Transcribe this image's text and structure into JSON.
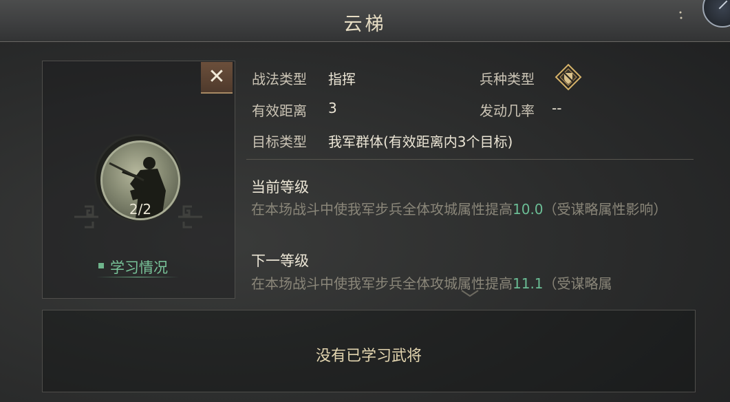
{
  "window": {
    "title": "云梯"
  },
  "close_button": {
    "glyph": "✕"
  },
  "skill": {
    "level_progress": "2/2",
    "study_label": "学习情况"
  },
  "attributes": {
    "tactic_type_label": "战法类型",
    "tactic_type_value": "指挥",
    "troop_type_label": "兵种类型",
    "troop_type_icon": "shield-diamond-icon",
    "range_label": "有效距离",
    "range_value": "3",
    "trigger_rate_label": "发动几率",
    "trigger_rate_value": "--",
    "target_type_label": "目标类型",
    "target_type_value": "我军群体(有效距离内3个目标)"
  },
  "current_level": {
    "title": "当前等级",
    "desc_prefix": "在本场战斗中使我军步兵全体攻城属性提高",
    "value": "10.0",
    "desc_suffix": "（受谋略属性影响）"
  },
  "next_level": {
    "title": "下一等级",
    "desc_prefix": "在本场战斗中使我军步兵全体攻城属性提高",
    "value": "11.1",
    "desc_suffix": "（受谋略属"
  },
  "generals": {
    "empty_text": "没有已学习武将"
  },
  "colors": {
    "highlight": "#6bbd95",
    "accent_gold": "#d6b36a",
    "close_bg": "#5c4534"
  }
}
